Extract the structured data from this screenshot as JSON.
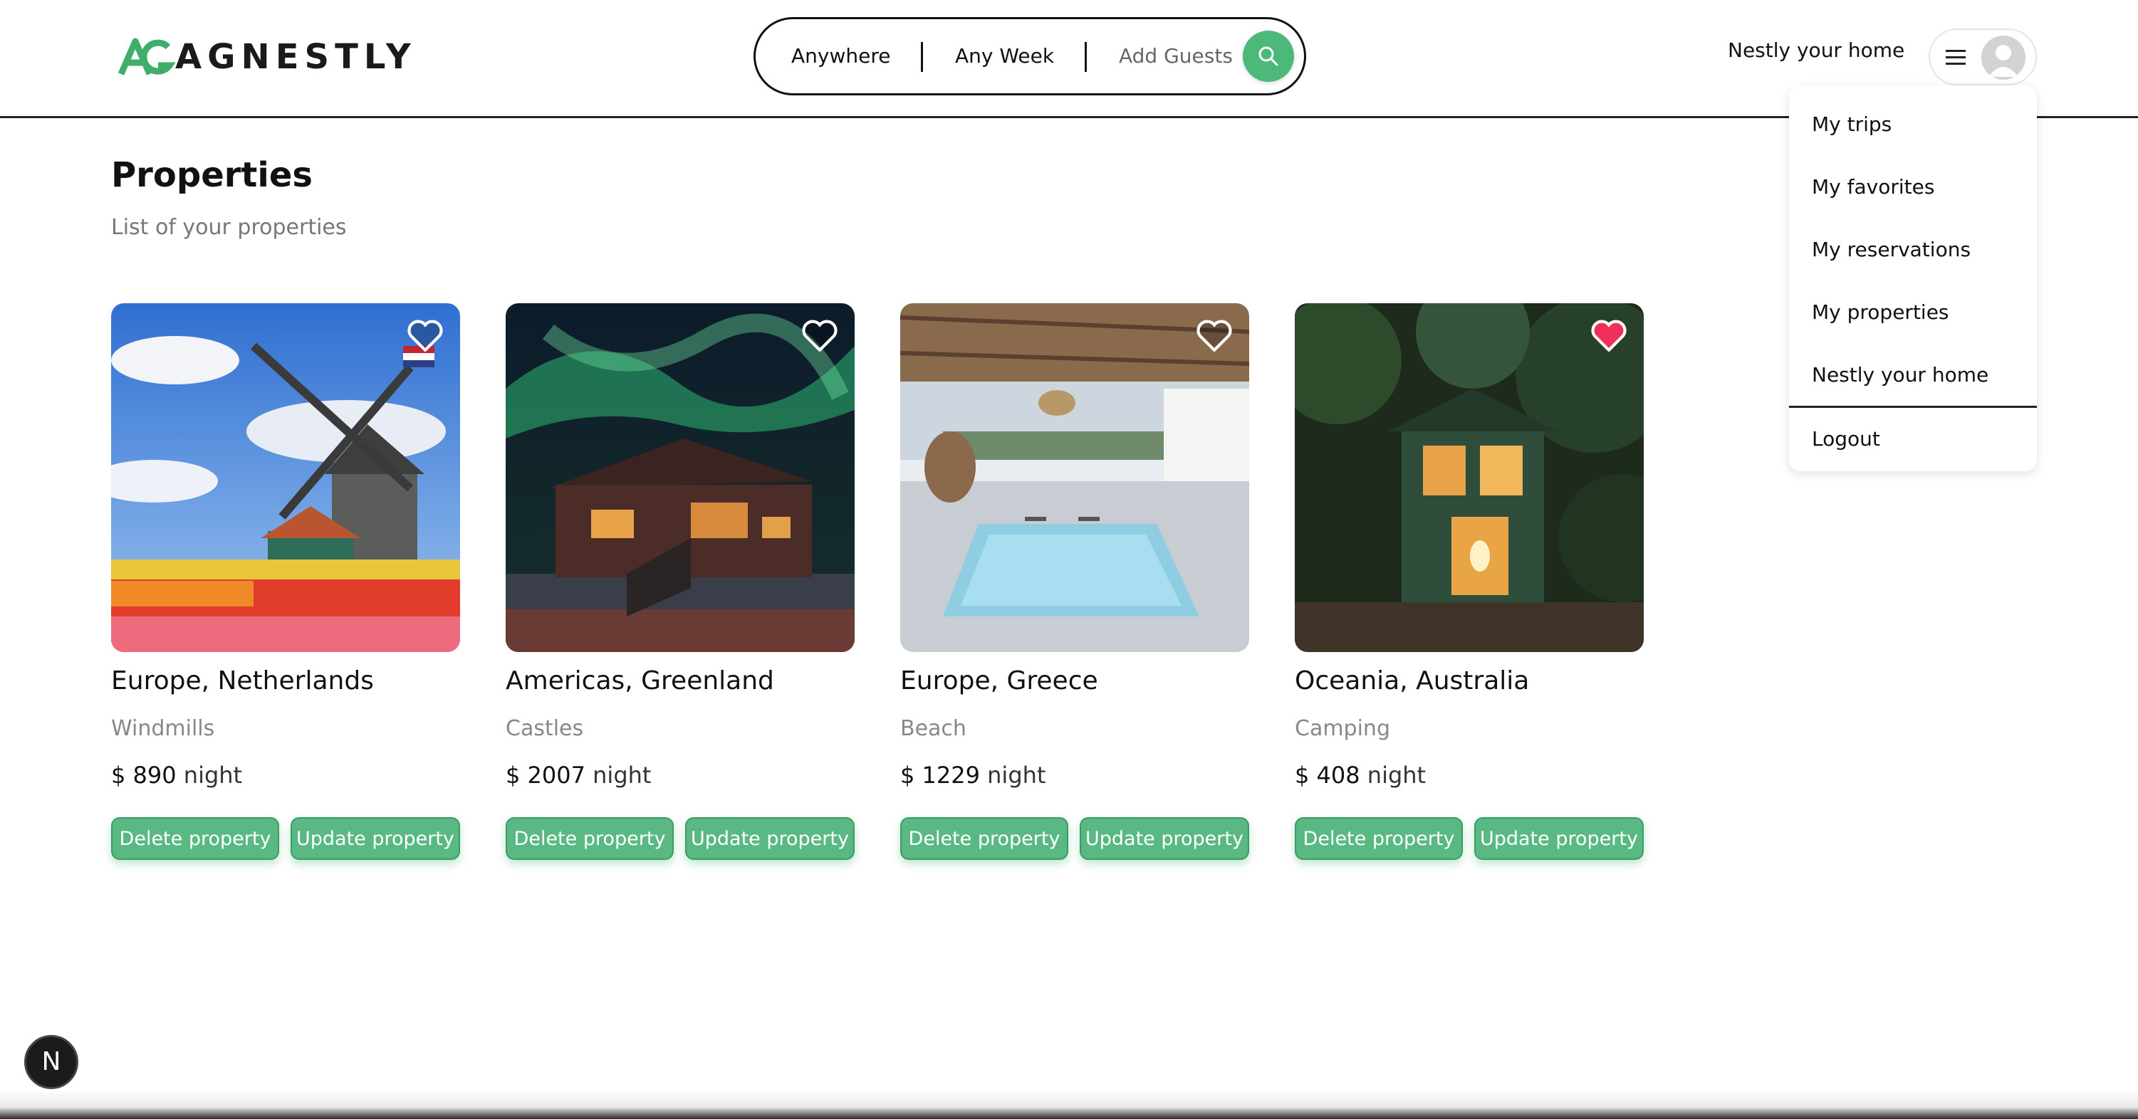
{
  "header": {
    "logo_text": "AGNESTLY",
    "search": {
      "anywhere": "Anywhere",
      "week": "Any Week",
      "guests": "Add Guests",
      "icon": "search-icon"
    },
    "host_link": "Nestly your home",
    "menu_icon": "hamburger-icon",
    "avatar_icon": "avatar-placeholder"
  },
  "dropdown": {
    "items": [
      "My trips",
      "My favorites",
      "My reservations",
      "My properties",
      "Nestly your home"
    ],
    "logout": "Logout"
  },
  "page": {
    "title": "Properties",
    "subtitle": "List of your properties"
  },
  "properties": [
    {
      "location": "Europe, Netherlands",
      "category": "Windmills",
      "price": "$ 890",
      "unit": "night",
      "favorite": false,
      "delete_label": "Delete property",
      "update_label": "Update property"
    },
    {
      "location": "Americas, Greenland",
      "category": "Castles",
      "price": "$ 2007",
      "unit": "night",
      "favorite": false,
      "delete_label": "Delete property",
      "update_label": "Update property"
    },
    {
      "location": "Europe, Greece",
      "category": "Beach",
      "price": "$ 1229",
      "unit": "night",
      "favorite": false,
      "delete_label": "Delete property",
      "update_label": "Update property"
    },
    {
      "location": "Oceania, Australia",
      "category": "Camping",
      "price": "$ 408",
      "unit": "night",
      "favorite": true,
      "delete_label": "Delete property",
      "update_label": "Update property"
    }
  ],
  "colors": {
    "accent": "#4cb87a",
    "favorite": "#f0305a"
  },
  "dev_badge": "N"
}
